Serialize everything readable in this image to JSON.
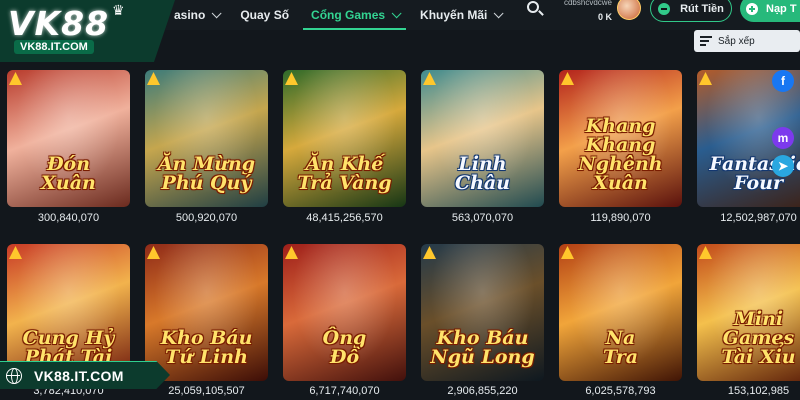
{
  "logo": {
    "brand": "VK88",
    "domain": "VK88.IT.COM"
  },
  "nav": {
    "items": [
      {
        "label": "asino",
        "has_dropdown": true,
        "active": false
      },
      {
        "label": "Quay Số",
        "has_dropdown": false,
        "active": false
      },
      {
        "label": "Cổng Games",
        "has_dropdown": true,
        "active": true
      },
      {
        "label": "Khuyến Mãi",
        "has_dropdown": true,
        "active": false
      }
    ]
  },
  "user": {
    "username": "cdbshcvdcwe",
    "balance": "0 K"
  },
  "buttons": {
    "withdraw": "Rút Tiền",
    "deposit": "Nạp T"
  },
  "sort": {
    "label": "Sắp xếp"
  },
  "games": [
    {
      "title_line1": "Đón",
      "title_line2": "Xuân",
      "amount": "300,840,070",
      "colors": [
        "#b83b2c",
        "#f0b19c",
        "#6a2a1e"
      ],
      "white_title": false
    },
    {
      "title_line1": "Ăn Mừng",
      "title_line2": "Phú Quý",
      "amount": "500,920,070",
      "colors": [
        "#3c7b7a",
        "#c5a64e",
        "#1f3e43"
      ],
      "white_title": false
    },
    {
      "title_line1": "Ăn Khế",
      "title_line2": "Trả Vàng",
      "amount": "48,415,256,570",
      "colors": [
        "#2f6a2a",
        "#d6a93c",
        "#163615"
      ],
      "white_title": false
    },
    {
      "title_line1": "Linh",
      "title_line2": "Châu",
      "amount": "563,070,070",
      "colors": [
        "#3f8b8f",
        "#e7c58a",
        "#204a50"
      ],
      "white_title": true
    },
    {
      "title_line1": "Khang Khang",
      "title_line2": "Nghênh Xuân",
      "amount": "119,890,070",
      "colors": [
        "#b3231c",
        "#f3a04a",
        "#5a110d"
      ],
      "white_title": false
    },
    {
      "title_line1": "Fantastic",
      "title_line2": "Four",
      "amount": "12,502,987,070",
      "colors": [
        "#b45b28",
        "#2a5d8f",
        "#3d1f12"
      ],
      "white_title": true
    },
    {
      "title_line1": "Cung Hỷ",
      "title_line2": "Phát Tài",
      "amount": "3,782,410,070",
      "colors": [
        "#c83a26",
        "#f2b34d",
        "#6a140b"
      ],
      "white_title": false
    },
    {
      "title_line1": "Kho Báu",
      "title_line2": "Tứ Linh",
      "amount": "25,059,105,507",
      "colors": [
        "#8f2a18",
        "#d8792a",
        "#3c0d07"
      ],
      "white_title": false
    },
    {
      "title_line1": "Ông",
      "title_line2": "Đồ",
      "amount": "6,717,740,070",
      "colors": [
        "#9e1f1a",
        "#d96a3a",
        "#42100c"
      ],
      "white_title": false
    },
    {
      "title_line1": "Kho Báu",
      "title_line2": "Ngũ Long",
      "amount": "2,906,855,220",
      "colors": [
        "#243a4a",
        "#6a4f2a",
        "#0e1820"
      ],
      "white_title": false
    },
    {
      "title_line1": "Na",
      "title_line2": "Tra",
      "amount": "6,025,578,793",
      "colors": [
        "#b23f14",
        "#f1a53a",
        "#401405"
      ],
      "white_title": false
    },
    {
      "title_line1": "Mini Games",
      "title_line2": "Tài Xỉu",
      "amount": "153,102,985",
      "colors": [
        "#c24a1a",
        "#f4c04c",
        "#5a1c08"
      ],
      "white_title": false
    }
  ],
  "social": [
    {
      "icon": "facebook-icon",
      "glyph": "f",
      "color": "#1877f2"
    },
    {
      "icon": "messenger-icon",
      "glyph": "m",
      "color": "#7c3aed"
    },
    {
      "icon": "telegram-icon",
      "glyph": "➤",
      "color": "#2aa7e0"
    }
  ],
  "banner": {
    "text": "VK88.IT.COM"
  }
}
